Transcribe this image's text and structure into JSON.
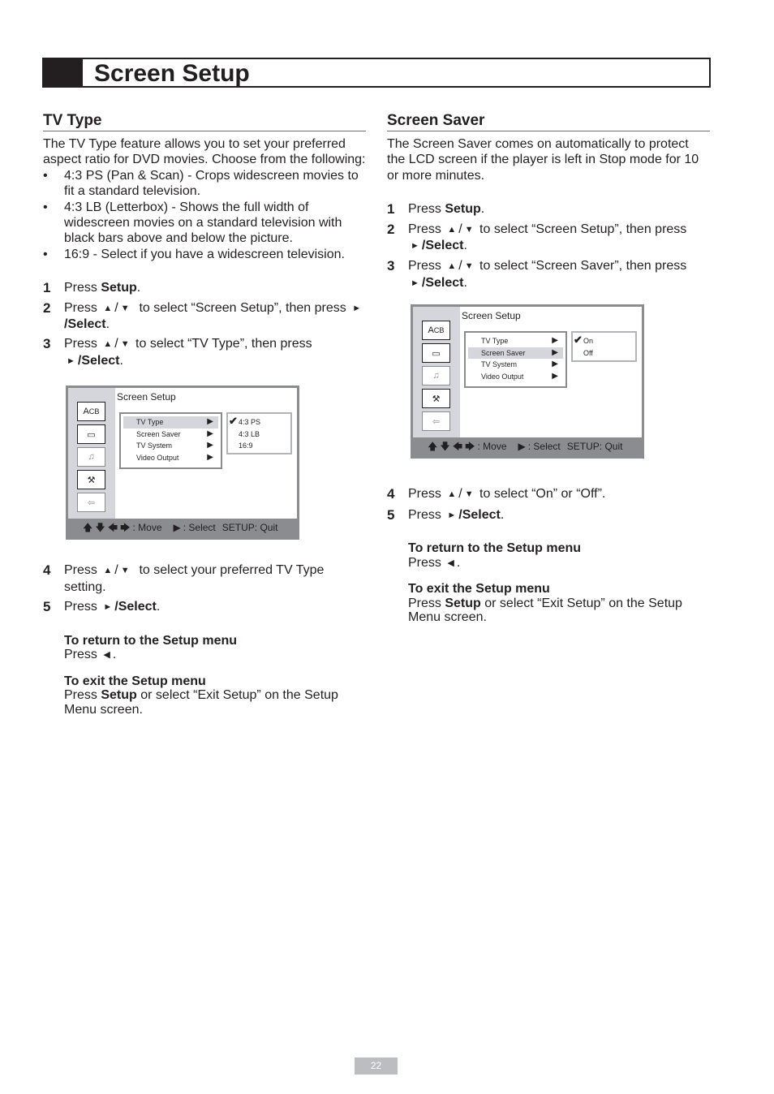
{
  "page_title": "Screen Setup",
  "page_number": "22",
  "icons": {
    "up": "▲",
    "down": "▼",
    "right": "►",
    "left": "◀",
    "slash": "/",
    "arrow_up": "🡅",
    "arrow_down": "🡇",
    "arrow_left": "🡄",
    "arrow_right": "🡆",
    "check": "✔",
    "menu_arrow": "▶"
  },
  "tv_type": {
    "heading": "TV Type",
    "intro": "The TV Type feature allows you to set your preferred aspect ratio for DVD movies. Choose from the following:",
    "bullets": [
      "4:3 PS (Pan & Scan) - Crops widescreen movies to fit a standard television.",
      "4:3 LB (Letterbox) - Shows the full width of widescreen movies on a standard television with black bars above and below the picture.",
      "16:9 - Select if you have a widescreen television."
    ],
    "steps": {
      "s1": {
        "num": "1",
        "pre": "Press ",
        "bold": "Setup",
        "post": "."
      },
      "s2": {
        "num": "2",
        "pre": "Press",
        "mid": "to select “Screen Setup”, then press",
        "bold": "/Select",
        "post": "."
      },
      "s3": {
        "num": "3",
        "pre": "Press",
        "mid": "to select “TV Type”, then press",
        "bold": "/Select",
        "post": "."
      },
      "s4": {
        "num": "4",
        "pre": "Press",
        "mid": "to select your preferred TV Type setting."
      },
      "s5": {
        "num": "5",
        "pre": "Press",
        "bold": "/Select",
        "post": "."
      }
    },
    "osd": {
      "title": "Screen Setup",
      "menu": [
        "TV Type",
        "Screen Saver",
        "TV System",
        "Video Output"
      ],
      "selected_menu": "TV Type",
      "options": [
        "4:3  PS",
        "4:3  LB",
        "16:9"
      ],
      "checked_option": "4:3  PS",
      "footer_move": ": Move",
      "footer_select": ": Select",
      "footer_quit": "SETUP: Quit"
    }
  },
  "screen_saver": {
    "heading": "Screen Saver",
    "intro": "The Screen Saver comes on automatically to protect the LCD screen if the player is left in Stop mode for 10 or more minutes.",
    "steps": {
      "s1": {
        "num": "1",
        "pre": "Press ",
        "bold": "Setup",
        "post": "."
      },
      "s2": {
        "num": "2",
        "pre": "Press",
        "mid": "to select “Screen Setup”, then press",
        "bold": "/Select",
        "post": "."
      },
      "s3": {
        "num": "3",
        "pre": "Press",
        "mid": "to select “Screen Saver”, then press",
        "bold": "/Select",
        "post": "."
      },
      "s4": {
        "num": "4",
        "pre": "Press",
        "mid": "to select “On” or “Off”."
      },
      "s5": {
        "num": "5",
        "pre": "Press",
        "bold": "/Select",
        "post": "."
      }
    },
    "osd": {
      "title": "Screen Setup",
      "menu": [
        "TV Type",
        "Screen Saver",
        "TV System",
        "Video Output"
      ],
      "selected_menu": "Screen Saver",
      "options": [
        "On",
        "Off"
      ],
      "checked_option": "On",
      "footer_move": ": Move",
      "footer_select": ": Select",
      "footer_quit": "SETUP: Quit"
    }
  },
  "notes": {
    "return_head": "To return to the Setup menu",
    "return_text": "Press",
    "return_post": ".",
    "exit_head": "To exit the Setup menu",
    "exit_pre": "Press ",
    "exit_bold": "Setup",
    "exit_post": " or select “Exit Setup” on the Setup Menu screen."
  }
}
